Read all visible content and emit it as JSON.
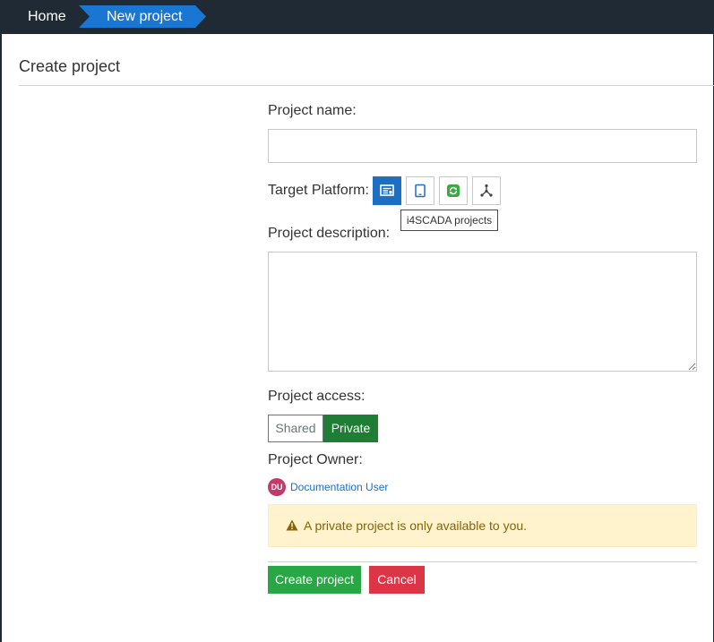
{
  "breadcrumb": {
    "home": "Home",
    "current": "New project"
  },
  "page": {
    "title": "Create project"
  },
  "form": {
    "project_name": {
      "label": "Project name:",
      "value": "",
      "placeholder": ""
    },
    "target_platform": {
      "label": "Target Platform:",
      "options": [
        {
          "icon": "scada-screen-icon",
          "selected": true
        },
        {
          "icon": "tablet-icon",
          "selected": false
        },
        {
          "icon": "refresh-circle-icon",
          "selected": false
        },
        {
          "icon": "network-node-icon",
          "selected": false
        }
      ],
      "tooltip": "i4SCADA projects"
    },
    "description": {
      "label": "Project description:",
      "value": ""
    },
    "access": {
      "label": "Project access:",
      "options": [
        "Shared",
        "Private"
      ],
      "selected": "Private"
    },
    "owner": {
      "label": "Project Owner:",
      "initials": "DU",
      "name": "Documentation User"
    },
    "alert": {
      "icon": "warning-icon",
      "message": "A private project is only available to you."
    },
    "buttons": {
      "create": "Create project",
      "cancel": "Cancel"
    }
  },
  "colors": {
    "topbar": "#1f2a34",
    "breadcrumb_active": "#1976d2",
    "platform_selected": "#1d6fc2",
    "private_toggle": "#1e7e34",
    "create_button": "#28a745",
    "cancel_button": "#dc3545",
    "alert_bg": "#fff3cd",
    "avatar": "#c2396b",
    "owner_link": "#1a6fc7"
  }
}
